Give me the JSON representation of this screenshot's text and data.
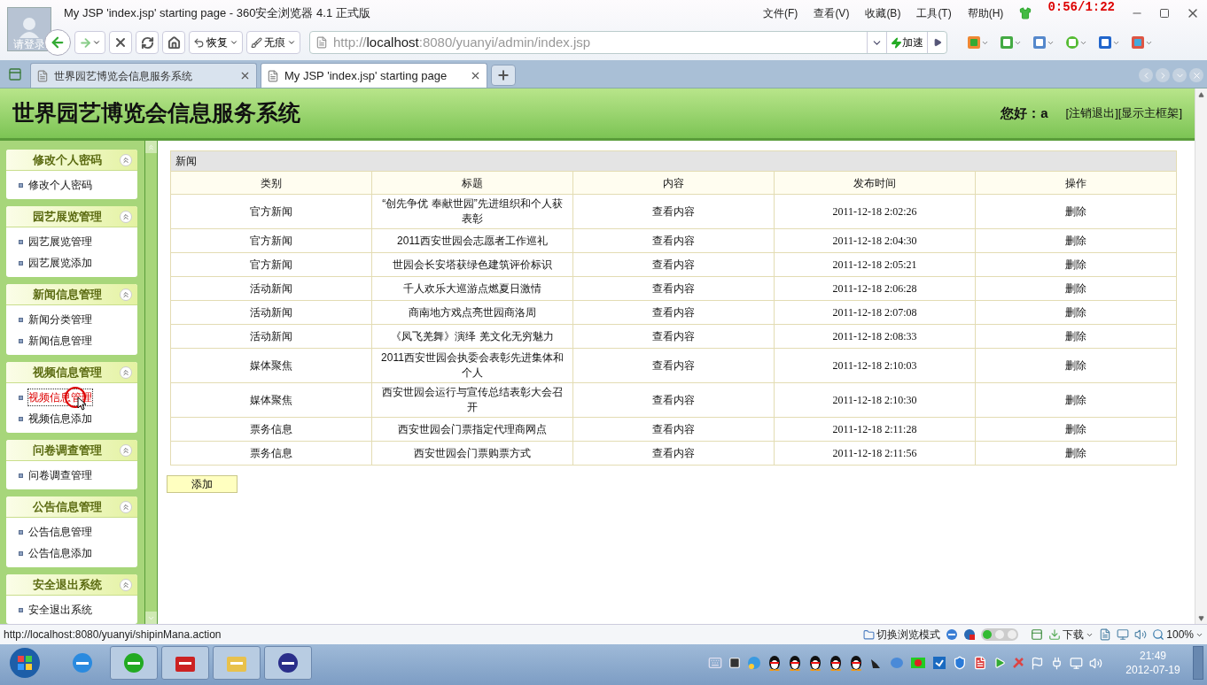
{
  "browser": {
    "login_label": "请登录",
    "title": "My JSP 'index.jsp' starting page - 360安全浏览器 4.1 正式版",
    "menu": [
      "文件(F)",
      "查看(V)",
      "收藏(B)",
      "工具(T)",
      "帮助(H)"
    ],
    "timer": "0:56/1:22",
    "toolbar": {
      "restore": "恢复",
      "incognito": "无痕",
      "url_scheme": "http://",
      "url_host": "localhost",
      "url_path": ":8080/yuanyi/admin/index.jsp",
      "speedup": "加速"
    },
    "tabs": [
      {
        "label": "世界园艺博览会信息服务系统",
        "selected": false
      },
      {
        "label": "My JSP 'index.jsp' starting page",
        "selected": true
      }
    ]
  },
  "page": {
    "title": "世界园艺博览会信息服务系统",
    "greeting": "您好：a",
    "links": [
      "[注销退出]",
      "[显示主框架]"
    ]
  },
  "sidebar": [
    {
      "title": "修改个人密码",
      "expanded": true,
      "items": [
        {
          "label": "修改个人密码",
          "selected": false
        }
      ]
    },
    {
      "title": "园艺展览管理",
      "expanded": true,
      "items": [
        {
          "label": "园艺展览管理",
          "selected": false
        },
        {
          "label": "园艺展览添加",
          "selected": false
        }
      ]
    },
    {
      "title": "新闻信息管理",
      "expanded": true,
      "items": [
        {
          "label": "新闻分类管理",
          "selected": false
        },
        {
          "label": "新闻信息管理",
          "selected": false
        }
      ]
    },
    {
      "title": "视频信息管理",
      "expanded": true,
      "items": [
        {
          "label": "视频信息管理",
          "selected": true
        },
        {
          "label": "视频信息添加",
          "selected": false
        }
      ]
    },
    {
      "title": "问卷调查管理",
      "expanded": true,
      "items": [
        {
          "label": "问卷调查管理",
          "selected": false
        }
      ]
    },
    {
      "title": "公告信息管理",
      "expanded": true,
      "items": [
        {
          "label": "公告信息管理",
          "selected": false
        },
        {
          "label": "公告信息添加",
          "selected": false
        }
      ]
    },
    {
      "title": "安全退出系统",
      "expanded": true,
      "items": [
        {
          "label": "安全退出系统",
          "selected": false
        }
      ]
    }
  ],
  "table": {
    "caption": "新闻",
    "columns": [
      "类别",
      "标题",
      "内容",
      "发布时间",
      "操作"
    ],
    "rows": [
      [
        "官方新闻",
        "“创先争优 奉献世园”先进组织和个人获表彰",
        "查看内容",
        "2011-12-18 2:02:26",
        "删除"
      ],
      [
        "官方新闻",
        "2011西安世园会志愿者工作巡礼",
        "查看内容",
        "2011-12-18 2:04:30",
        "删除"
      ],
      [
        "官方新闻",
        "世园会长安塔获绿色建筑评价标识",
        "查看内容",
        "2011-12-18 2:05:21",
        "删除"
      ],
      [
        "活动新闻",
        "千人欢乐大巡游点燃夏日激情",
        "查看内容",
        "2011-12-18 2:06:28",
        "删除"
      ],
      [
        "活动新闻",
        "商南地方戏点亮世园商洛周",
        "查看内容",
        "2011-12-18 2:07:08",
        "删除"
      ],
      [
        "活动新闻",
        "《凤飞羌舞》演绎 羌文化无穷魅力",
        "查看内容",
        "2011-12-18 2:08:33",
        "删除"
      ],
      [
        "媒体聚焦",
        "2011西安世园会执委会表彰先进集体和个人",
        "查看内容",
        "2011-12-18 2:10:03",
        "删除"
      ],
      [
        "媒体聚焦",
        "西安世园会运行与宣传总结表彰大会召开",
        "查看内容",
        "2011-12-18 2:10:30",
        "删除"
      ],
      [
        "票务信息",
        "西安世园会门票指定代理商网点",
        "查看内容",
        "2011-12-18 2:11:28",
        "删除"
      ],
      [
        "票务信息",
        "西安世园会门票购票方式",
        "查看内容",
        "2011-12-18 2:11:56",
        "删除"
      ]
    ]
  },
  "add_button": "添加",
  "status_bar": {
    "url": "http://localhost:8080/yuanyi/shipinMana.action",
    "mode": "切换浏览模式",
    "download": "下载",
    "zoom": "100%"
  },
  "taskbar": {
    "time": "21:49",
    "date": "2012-07-19"
  }
}
